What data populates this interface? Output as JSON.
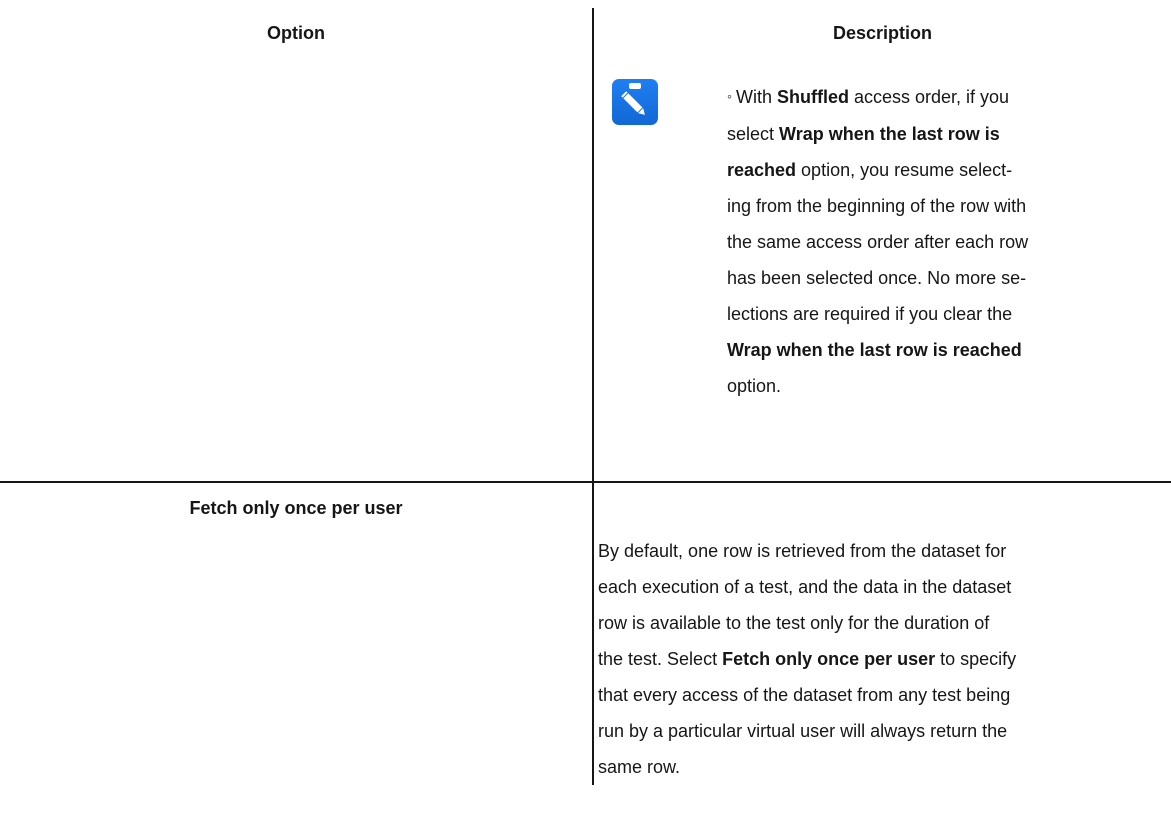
{
  "table": {
    "headers": {
      "option": "Option",
      "description": "Description"
    },
    "note": {
      "icon": "pencil-note-icon",
      "bullet": "◦",
      "lines": [
        [
          {
            "t": "With "
          },
          {
            "t": "Shuffled",
            "b": true
          },
          {
            "t": " access order, if you"
          }
        ],
        [
          {
            "t": "select "
          },
          {
            "t": "Wrap when the last row is",
            "b": true
          }
        ],
        [
          {
            "t": "reached",
            "b": true
          },
          {
            "t": " option, you resume select-"
          }
        ],
        [
          {
            "t": "ing from the beginning of the row with"
          }
        ],
        [
          {
            "t": "the same access order after each row"
          }
        ],
        [
          {
            "t": "has been selected once. No more se-"
          }
        ],
        [
          {
            "t": "lections are required if you clear the"
          }
        ],
        [
          {
            "t": "Wrap when the last row is reached",
            "b": true
          }
        ],
        [
          {
            "t": "option."
          }
        ]
      ]
    },
    "rows": [
      {
        "option": "Fetch only once per user",
        "description_lines": [
          [
            {
              "t": "By default, one row is retrieved from the dataset for"
            }
          ],
          [
            {
              "t": "each execution of a test, and the data in the dataset"
            }
          ],
          [
            {
              "t": "row is available to the test only for the duration of"
            }
          ],
          [
            {
              "t": "the test. Select "
            },
            {
              "t": "Fetch only once per user",
              "b": true
            },
            {
              "t": " to specify"
            }
          ],
          [
            {
              "t": "that every access of the dataset from any test being"
            }
          ],
          [
            {
              "t": "run by a particular virtual user will always return the"
            }
          ],
          [
            {
              "t": "same row."
            }
          ]
        ]
      }
    ]
  }
}
